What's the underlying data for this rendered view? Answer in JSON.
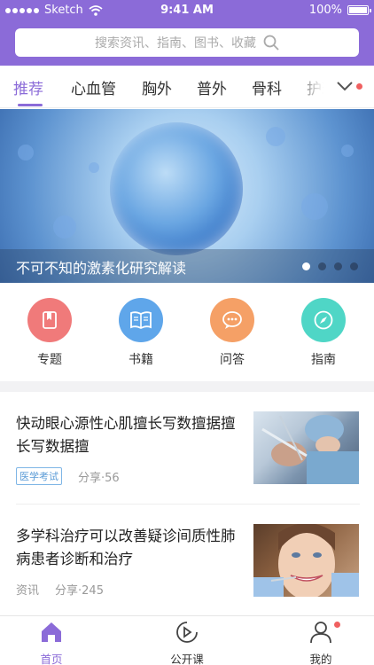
{
  "status_bar": {
    "carrier": "Sketch",
    "time": "9:41 AM",
    "battery": "100%"
  },
  "search": {
    "placeholder": "搜索资讯、指南、图书、收藏",
    "icon": "search-icon"
  },
  "tabs": [
    {
      "label": "推荐",
      "active": true
    },
    {
      "label": "心血管"
    },
    {
      "label": "胸外"
    },
    {
      "label": "普外"
    },
    {
      "label": "骨科"
    },
    {
      "label": "护理"
    }
  ],
  "banner": {
    "title": "不可不知的激素化研究解读",
    "pages": 4,
    "current_page": 1
  },
  "quick_entries": [
    {
      "label": "专题",
      "icon": "bookmark-icon",
      "color": "#f07a7a"
    },
    {
      "label": "书籍",
      "icon": "book-icon",
      "color": "#5fa6ea"
    },
    {
      "label": "问答",
      "icon": "chat-icon",
      "color": "#f5a066"
    },
    {
      "label": "指南",
      "icon": "compass-icon",
      "color": "#4fd6c6"
    }
  ],
  "articles": [
    {
      "title": "快动眼心源性心肌擅长写数擅据擅长写数据擅",
      "tag": "医学考试",
      "share": "分享·56"
    },
    {
      "title": "多学科治疗可以改善疑诊间质性肺病患者诊断和治疗",
      "category": "资讯",
      "share": "分享·245"
    }
  ],
  "bottom_nav": [
    {
      "label": "首页",
      "icon": "home-icon",
      "active": true
    },
    {
      "label": "公开课",
      "icon": "play-icon"
    },
    {
      "label": "我的",
      "icon": "user-icon",
      "badge": true
    }
  ],
  "colors": {
    "brand": "#8b6bd8",
    "badge": "#f06060"
  }
}
